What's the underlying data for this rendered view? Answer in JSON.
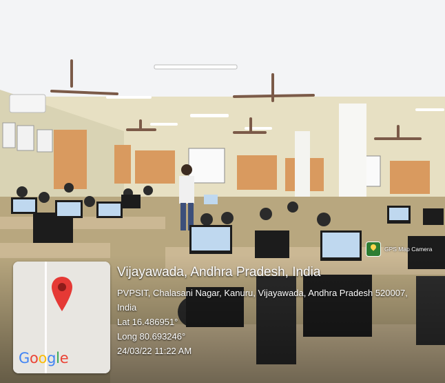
{
  "location": {
    "title": "Vijayawada, Andhra Pradesh, India",
    "address_line1": "PVPSIT, Chalasani Nagar, Kanuru, Vijayawada, Andhra Pradesh 520007,",
    "address_line2": "India",
    "latitude": "Lat 16.486951°",
    "longitude": "Long 80.693246°",
    "timestamp": "24/03/22 11:22 AM"
  },
  "watermark": {
    "label": "GPS Map Camera",
    "icon": "gps-map-camera-icon"
  },
  "map_thumbnail": {
    "logo_text": "Google",
    "marker_icon": "map-pin-icon"
  },
  "colors": {
    "pin_red": "#e53935",
    "google_blue": "#4285F4",
    "google_red": "#EA4335",
    "google_yellow": "#FBBC05",
    "google_green": "#34A853"
  }
}
